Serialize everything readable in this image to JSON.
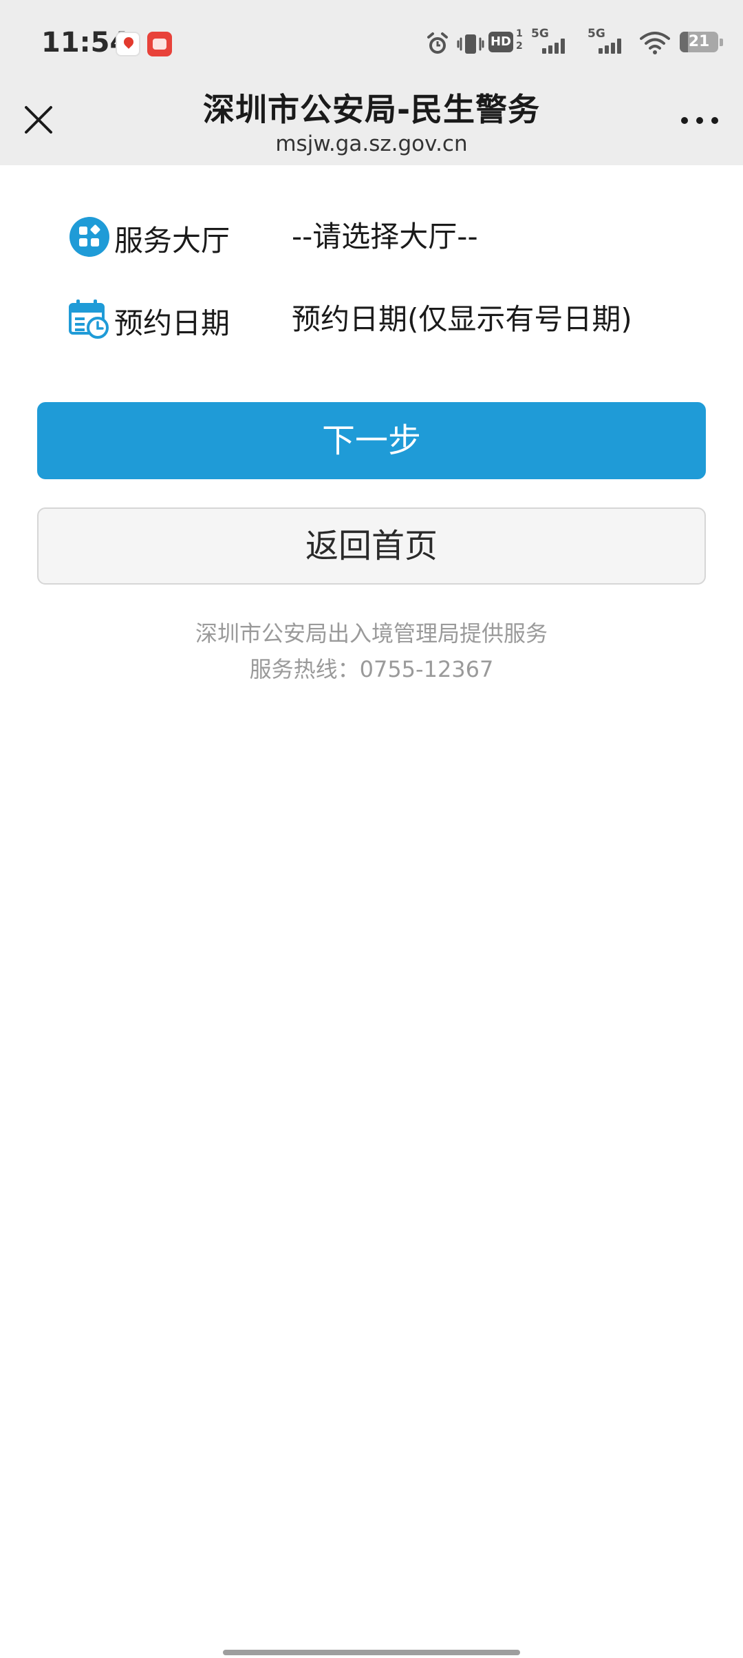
{
  "status_bar": {
    "time": "11:54",
    "hd_label": "HD",
    "hd_sub_top": "1",
    "hd_sub_bottom": "2",
    "sim1_label": "5G",
    "sim2_label": "5G",
    "battery_level": "21",
    "battery_fraction": 0.21
  },
  "header": {
    "title": "深圳市公安局-民生警务",
    "url": "msjw.ga.sz.gov.cn"
  },
  "form": {
    "hall_label": "服务大厅",
    "hall_value": "--请选择大厅--",
    "date_label": "预约日期",
    "date_value": "预约日期(仅显示有号日期)"
  },
  "buttons": {
    "next_label": "下一步",
    "home_label": "返回首页"
  },
  "footer": {
    "provider": "深圳市公安局出入境管理局提供服务",
    "hotline": "服务热线：0755-12367"
  },
  "colors": {
    "accent": "#1f9bd7",
    "header_bg": "#ededed",
    "footer_text": "#9a9a9a"
  },
  "icons": {
    "hall": "apps-grid-icon",
    "date": "calendar-clock-icon",
    "close": "close-icon",
    "more": "more-dots-icon"
  }
}
